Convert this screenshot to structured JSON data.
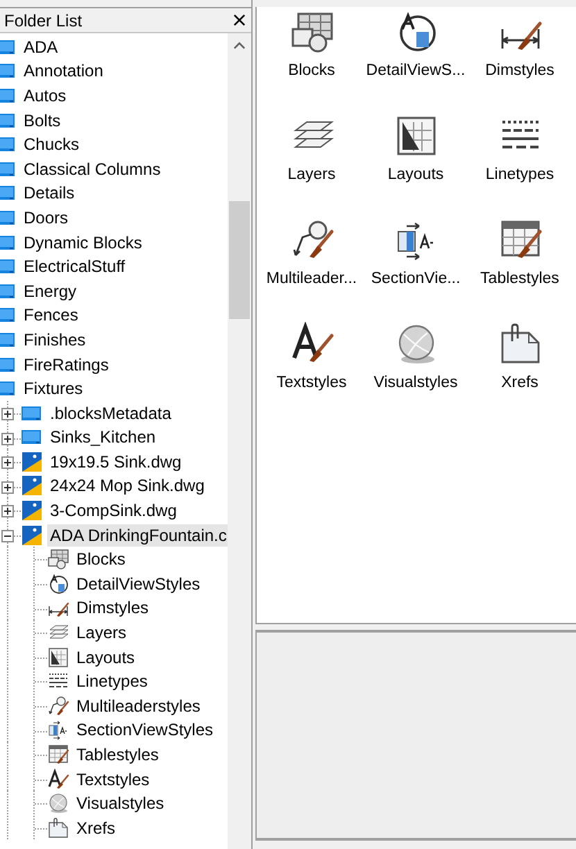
{
  "folder_list": {
    "title": "Folder List",
    "items": [
      {
        "label": "ADA",
        "kind": "folder"
      },
      {
        "label": "Annotation",
        "kind": "folder"
      },
      {
        "label": "Autos",
        "kind": "folder"
      },
      {
        "label": "Bolts",
        "kind": "folder"
      },
      {
        "label": "Chucks",
        "kind": "folder"
      },
      {
        "label": "Classical Columns",
        "kind": "folder"
      },
      {
        "label": "Details",
        "kind": "folder"
      },
      {
        "label": "Doors",
        "kind": "folder"
      },
      {
        "label": "Dynamic Blocks",
        "kind": "folder"
      },
      {
        "label": "ElectricalStuff",
        "kind": "folder"
      },
      {
        "label": "Energy",
        "kind": "folder"
      },
      {
        "label": "Fences",
        "kind": "folder"
      },
      {
        "label": "Finishes",
        "kind": "folder"
      },
      {
        "label": "FireRatings",
        "kind": "folder"
      },
      {
        "label": "Fixtures",
        "kind": "folder",
        "children": [
          {
            "label": ".blocksMetadata",
            "kind": "folder",
            "expanded": false,
            "selected": false
          },
          {
            "label": "Sinks_Kitchen",
            "kind": "folder",
            "expanded": false,
            "selected": false
          },
          {
            "label": "19x19.5 Sink.dwg",
            "kind": "drawing",
            "expanded": false,
            "selected": false
          },
          {
            "label": "24x24 Mop Sink.dwg",
            "kind": "drawing",
            "expanded": false,
            "selected": false
          },
          {
            "label": "3-CompSink.dwg",
            "kind": "drawing",
            "expanded": false,
            "selected": false
          },
          {
            "label": "ADA DrinkingFountain.c",
            "kind": "drawing",
            "expanded": true,
            "selected": true,
            "children": [
              {
                "label": "Blocks",
                "kind": "blocks"
              },
              {
                "label": "DetailViewStyles",
                "kind": "detail"
              },
              {
                "label": "Dimstyles",
                "kind": "dim"
              },
              {
                "label": "Layers",
                "kind": "layers"
              },
              {
                "label": "Layouts",
                "kind": "layouts"
              },
              {
                "label": "Linetypes",
                "kind": "linetypes"
              },
              {
                "label": "Multileaderstyles",
                "kind": "mleader"
              },
              {
                "label": "SectionViewStyles",
                "kind": "section"
              },
              {
                "label": "Tablestyles",
                "kind": "table"
              },
              {
                "label": "Textstyles",
                "kind": "text"
              },
              {
                "label": "Visualstyles",
                "kind": "visual"
              },
              {
                "label": "Xrefs",
                "kind": "xref"
              }
            ]
          }
        ]
      }
    ]
  },
  "content": {
    "items": [
      {
        "label": "Blocks",
        "kind": "blocks"
      },
      {
        "label": "DetailViewS...",
        "kind": "detail"
      },
      {
        "label": "Dimstyles",
        "kind": "dim"
      },
      {
        "label": "Layers",
        "kind": "layers"
      },
      {
        "label": "Layouts",
        "kind": "layouts"
      },
      {
        "label": "Linetypes",
        "kind": "linetypes"
      },
      {
        "label": "Multileader...",
        "kind": "mleader"
      },
      {
        "label": "SectionVie...",
        "kind": "section"
      },
      {
        "label": "Tablestyles",
        "kind": "table"
      },
      {
        "label": "Textstyles",
        "kind": "text"
      },
      {
        "label": "Visualstyles",
        "kind": "visual"
      },
      {
        "label": "Xrefs",
        "kind": "xref"
      }
    ]
  }
}
